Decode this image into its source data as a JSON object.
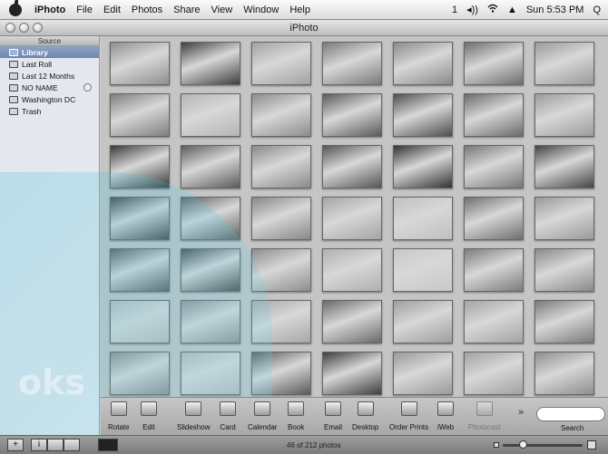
{
  "menubar": {
    "app": "iPhoto",
    "items": [
      "File",
      "Edit",
      "Photos",
      "Share",
      "View",
      "Window",
      "Help"
    ],
    "status": {
      "number": "1",
      "volume": "◂))",
      "wifi": "WiFi",
      "eject": "▲",
      "clock": "Sun 5:53 PM",
      "spotlight": "Q"
    }
  },
  "window": {
    "title": "iPhoto"
  },
  "sidebar": {
    "header": "Source",
    "items": [
      {
        "label": "Library",
        "selected": true
      },
      {
        "label": "Last Roll"
      },
      {
        "label": "Last 12 Months"
      },
      {
        "label": "NO NAME",
        "ejectable": true
      },
      {
        "label": "Washington DC"
      },
      {
        "label": "Trash"
      }
    ]
  },
  "toolbar": {
    "tools": [
      {
        "label": "Rotate"
      },
      {
        "label": "Edit"
      },
      {
        "label": "Slideshow"
      },
      {
        "label": "Card"
      },
      {
        "label": "Calendar"
      },
      {
        "label": "Book"
      },
      {
        "label": "Email"
      },
      {
        "label": "Desktop"
      },
      {
        "label": "Order Prints"
      },
      {
        "label": "iWeb"
      },
      {
        "label": "Photocast",
        "disabled": true
      }
    ],
    "more": "»",
    "search_label": "Search"
  },
  "bottombar": {
    "add": "+",
    "info": "i",
    "photo_count": "46 of 212 photos",
    "zoom_level": 0.25
  },
  "watermark": "oks",
  "photos": {
    "count": 49,
    "tones": [
      "#8f8f8f",
      "#3f3f3f",
      "#a2a2a2",
      "#7a7a7a",
      "#8a8a8a",
      "#6e6e6e",
      "#9a9a9a",
      "#7e7e7e",
      "#b5b5b5",
      "#8d8d8d",
      "#5a5a5a",
      "#4e4e4e",
      "#6a6a6a",
      "#9c9c9c",
      "#3a3a3a",
      "#5c5c5c",
      "#8a8a8a",
      "#555555",
      "#333333",
      "#777777",
      "#444444",
      "#4a4a4a",
      "#606060",
      "#888888",
      "#a5a5a5",
      "#c0c0c0",
      "#6f6f6f",
      "#9a9a9a",
      "#5e5e5e",
      "#4c4c4c",
      "#8e8e8e",
      "#b0b0b0",
      "#c8c8c8",
      "#7c7c7c",
      "#8a8a8a",
      "#bcbcbc",
      "#909090",
      "#a8a8a8",
      "#6a6a6a",
      "#9e9e9e",
      "#a4a4a4",
      "#7a7a7a",
      "#8c8c8c",
      "#b8b8b8",
      "#5a5a5a",
      "#3e3e3e",
      "#9a9a9a",
      "#a2a2a2",
      "#8e8e8e"
    ]
  }
}
